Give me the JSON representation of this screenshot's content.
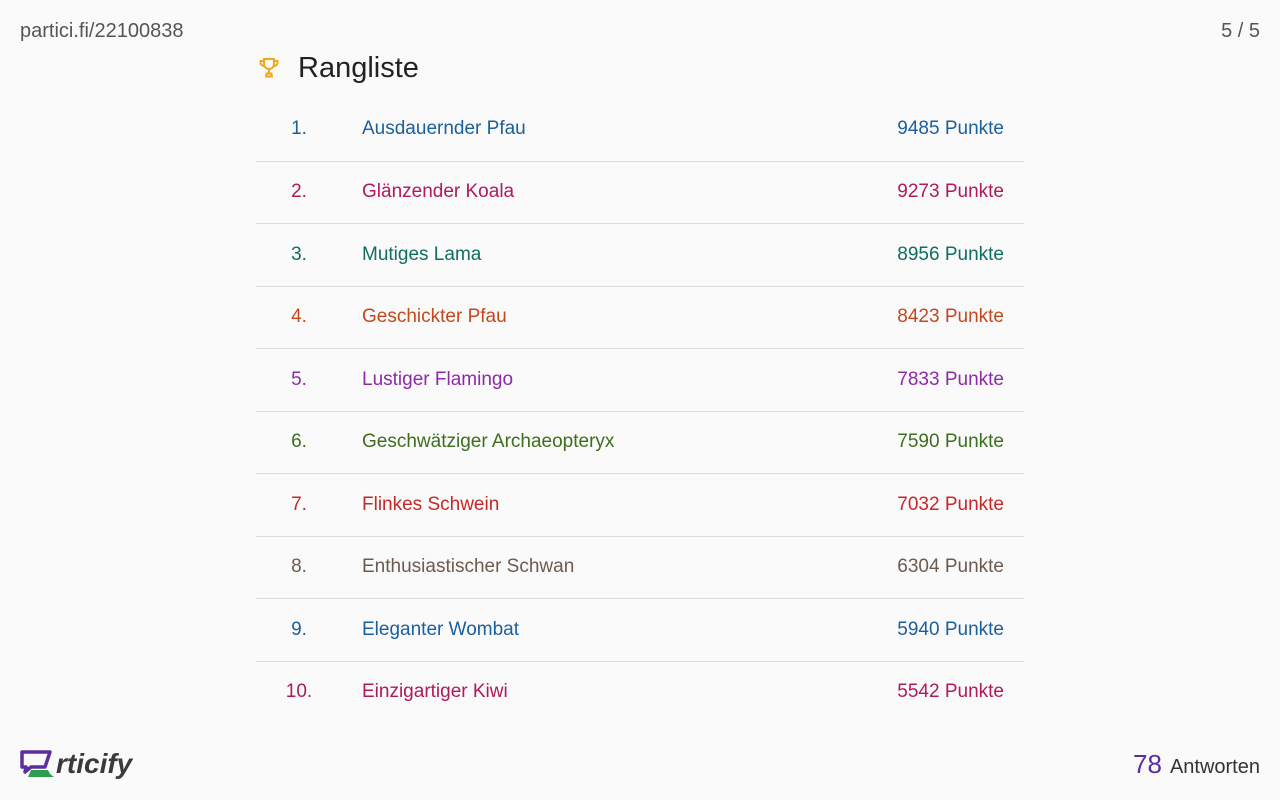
{
  "join_url": "partici.fi/22100838",
  "slide_counter": "5 / 5",
  "header": {
    "title": "Rangliste",
    "icon": "trophy-icon",
    "icon_color": "#f2a81d"
  },
  "leaderboard": [
    {
      "rank": "1.",
      "name": "Ausdauernder Pfau",
      "points": "9485 Punkte",
      "color": "#1a5f9e"
    },
    {
      "rank": "2.",
      "name": "Glänzender Koala",
      "points": "9273 Punkte",
      "color": "#b0195a"
    },
    {
      "rank": "3.",
      "name": "Mutiges Lama",
      "points": "8956 Punkte",
      "color": "#0f6e5f"
    },
    {
      "rank": "4.",
      "name": "Geschickter Pfau",
      "points": "8423 Punkte",
      "color": "#c4481e"
    },
    {
      "rank": "5.",
      "name": "Lustiger Flamingo",
      "points": "7833 Punkte",
      "color": "#8e2aa8"
    },
    {
      "rank": "6.",
      "name": "Geschwätziger Archaeopteryx",
      "points": "7590 Punkte",
      "color": "#3d6e1e"
    },
    {
      "rank": "7.",
      "name": "Flinkes Schwein",
      "points": "7032 Punkte",
      "color": "#c62828"
    },
    {
      "rank": "8.",
      "name": "Enthusiastischer Schwan",
      "points": "6304 Punkte",
      "color": "#6d5a4e"
    },
    {
      "rank": "9.",
      "name": "Eleganter Wombat",
      "points": "5940 Punkte",
      "color": "#1a5f9e"
    },
    {
      "rank": "10.",
      "name": "Einzigartiger Kiwi",
      "points": "5542 Punkte",
      "color": "#b0195a"
    }
  ],
  "footer": {
    "logo_text": "rticify",
    "logo_colors": {
      "purple": "#5d2ea0",
      "green": "#2e9e4e"
    },
    "responses_count": "78",
    "responses_label": "Antworten"
  }
}
